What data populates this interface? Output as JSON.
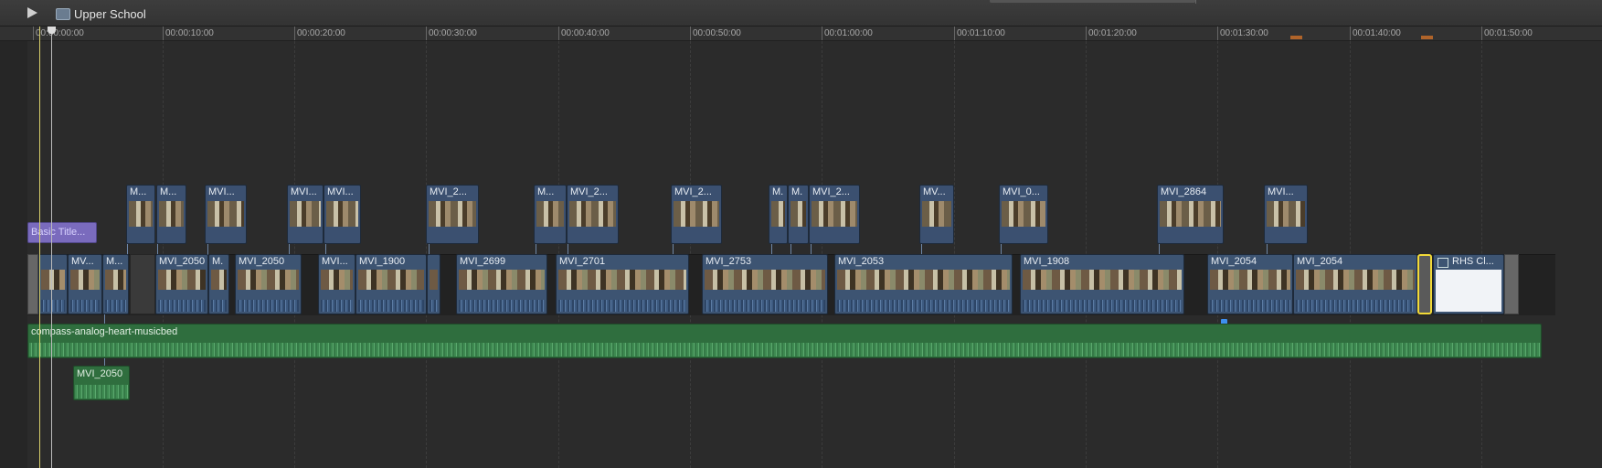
{
  "project": {
    "title": "Upper School"
  },
  "ruler": {
    "ticks": [
      "00:00:00:00",
      "00:00:10:00",
      "00:00:20:00",
      "00:00:30:00",
      "00:00:40:00",
      "00:00:50:00",
      "00:01:00:00",
      "00:01:10:00",
      "00:01:20:00",
      "00:01:30:00",
      "00:01:40:00",
      "00:01:50:00"
    ]
  },
  "title_clip": {
    "label": "Basic Title..."
  },
  "primary_clips": [
    {
      "label": ""
    },
    {
      "label": "MV..."
    },
    {
      "label": "M..."
    },
    {
      "label": "MVI_2050"
    },
    {
      "label": "M."
    },
    {
      "label": "MVI_2050"
    },
    {
      "label": "MVI..."
    },
    {
      "label": "MVI_1900"
    },
    {
      "label": ""
    },
    {
      "label": "MVI_2699"
    },
    {
      "label": "MVI_2701"
    },
    {
      "label": "MVI_2753"
    },
    {
      "label": "MVI_2053"
    },
    {
      "label": "MVI_1908"
    },
    {
      "label": "MVI_2054"
    },
    {
      "label": "MVI_2054"
    }
  ],
  "connected_clips": [
    {
      "label": "M..."
    },
    {
      "label": "M..."
    },
    {
      "label": "MVI..."
    },
    {
      "label": "MVI..."
    },
    {
      "label": "MVI..."
    },
    {
      "label": "MVI_2..."
    },
    {
      "label": "M..."
    },
    {
      "label": "MVI_2..."
    },
    {
      "label": "MVI_2..."
    },
    {
      "label": "M."
    },
    {
      "label": "M."
    },
    {
      "label": "MVI_2..."
    },
    {
      "label": "MV..."
    },
    {
      "label": "MVI_0..."
    },
    {
      "label": "MVI_2864"
    },
    {
      "label": "MVI..."
    }
  ],
  "end_clip": {
    "label": "RHS Cl..."
  },
  "music": {
    "label": "compass-analog-heart-musicbed"
  },
  "audio_clip": {
    "label": "MVI_2050"
  },
  "colors": {
    "primary_clip": "#3d5472",
    "audio": "#2f6e3e",
    "title": "#7a6bbd",
    "selection": "#f2da38",
    "playhead": "#d9d06a",
    "marker": "#b0642a"
  }
}
